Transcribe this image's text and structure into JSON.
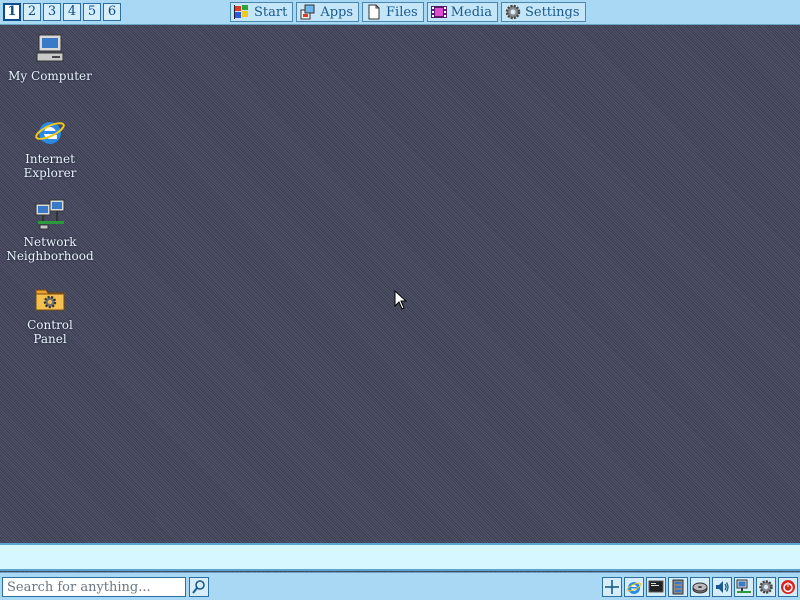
{
  "top_bar": {
    "workspaces": [
      "1",
      "2",
      "3",
      "4",
      "5",
      "6"
    ],
    "active_workspace": "1",
    "menus": [
      {
        "label": "Start",
        "icon": "windows-flag-icon"
      },
      {
        "label": "Apps",
        "icon": "apps-icon"
      },
      {
        "label": "Files",
        "icon": "document-icon"
      },
      {
        "label": "Media",
        "icon": "film-icon"
      },
      {
        "label": "Settings",
        "icon": "gear-icon"
      }
    ]
  },
  "desktop": {
    "icons": [
      {
        "label": "My Computer",
        "icon": "computer-icon"
      },
      {
        "label": "Internet\nExplorer",
        "icon": "internet-explorer-icon"
      },
      {
        "label": "Network\nNeighborhood",
        "icon": "network-icon"
      },
      {
        "label": "Control\nPanel",
        "icon": "control-panel-icon"
      }
    ]
  },
  "taskbar": {
    "search": {
      "placeholder": "Search for anything...",
      "value": ""
    },
    "tray_icons": [
      "crosshair-icon",
      "internet-explorer-icon",
      "terminal-icon",
      "server-icon",
      "disk-icon",
      "volume-icon",
      "network-icon",
      "gear-icon",
      "power-icon"
    ]
  },
  "colors": {
    "desktop_bg": "#44475a",
    "panel_bg": "#a8d8f4",
    "notification_strip_bg": "#d6f7ff",
    "accent": "#0b4d8a"
  }
}
